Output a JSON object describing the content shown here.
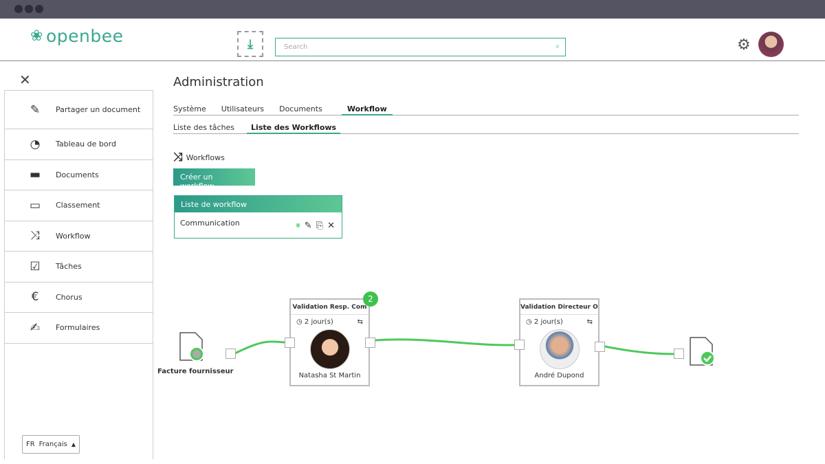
{
  "header": {
    "logo_text": "openbee",
    "search_placeholder": "Search"
  },
  "sidebar": {
    "items": [
      {
        "label": "Partager un document",
        "icon": "share-doc-icon",
        "glyph": "✎"
      },
      {
        "label": "Tableau de bord",
        "icon": "dashboard-icon",
        "glyph": "◔"
      },
      {
        "label": "Documents",
        "icon": "folder-icon",
        "glyph": "▬"
      },
      {
        "label": "Classement",
        "icon": "filing-icon",
        "glyph": "▭"
      },
      {
        "label": "Workflow",
        "icon": "workflow-icon",
        "glyph": "⤨"
      },
      {
        "label": "Tâches",
        "icon": "tasks-icon",
        "glyph": "☑"
      },
      {
        "label": "Chorus",
        "icon": "chorus-icon",
        "glyph": "€"
      },
      {
        "label": "Formulaires",
        "icon": "forms-icon",
        "glyph": "✍"
      }
    ],
    "lang_code": "FR",
    "lang_label": "Français"
  },
  "main": {
    "title": "Administration",
    "tabs": [
      "Système",
      "Utilisateurs",
      "Documents",
      "Workflow"
    ],
    "subtabs": [
      "Liste des tâches",
      "Liste des Workflows"
    ],
    "section": "Workflows",
    "create_button": "Créer un workflow",
    "panel_title": "Liste de workflow",
    "workflow_name": "Communication"
  },
  "diagram": {
    "start_label": "Facture fournisseur",
    "nodes": [
      {
        "title": "Validation Resp. Com",
        "delay": "2 jour(s)",
        "person": "Natasha St Martin",
        "badge": "2"
      },
      {
        "title": "Validation Directeur Opé",
        "delay": "2 jour(s)",
        "person": "André Dupond"
      }
    ]
  },
  "colors": {
    "accent": "#3aa88f",
    "line": "#4cc95a"
  }
}
